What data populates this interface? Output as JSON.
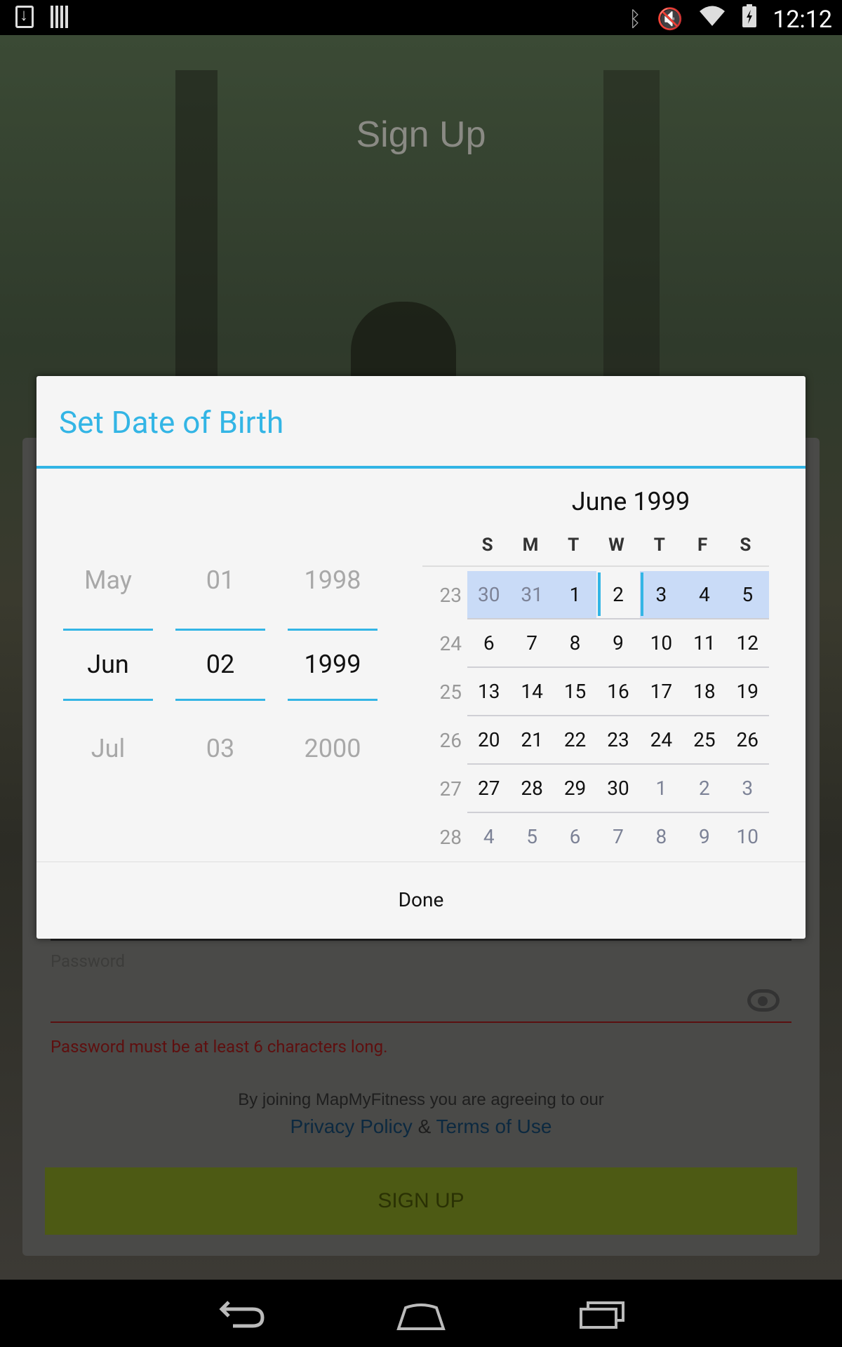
{
  "status_bar": {
    "time": "12:12",
    "left_icons": [
      "download-icon",
      "barcode-icon"
    ],
    "right_icons": [
      "bluetooth-icon",
      "mute-icon",
      "wifi-icon",
      "battery-charging-icon"
    ]
  },
  "background_app": {
    "title": "Sign Up",
    "password_label": "Password",
    "password_error": "Password must be at least 6 characters long.",
    "terms_line": "By joining MapMyFitness you are agreeing to our",
    "privacy_link": "Privacy Policy",
    "terms_ampersand": "&",
    "terms_link": "Terms of Use",
    "signup_button": "SIGN UP",
    "colors": {
      "error": "#5e0f0f",
      "link": "#0c2940",
      "signup_button": "#4d5a14"
    }
  },
  "dialog": {
    "title": "Set Date of Birth",
    "accent_color": "#33b5e5",
    "spinners": {
      "month": {
        "prev": "May",
        "current": "Jun",
        "next": "Jul"
      },
      "day": {
        "prev": "01",
        "current": "02",
        "next": "03"
      },
      "year": {
        "prev": "1998",
        "current": "1999",
        "next": "2000"
      }
    },
    "calendar": {
      "month_label": "June 1999",
      "weekday_headers": [
        "S",
        "M",
        "T",
        "W",
        "T",
        "F",
        "S"
      ],
      "weeks": [
        {
          "week": "23",
          "days": [
            "30",
            "31",
            "1",
            "2",
            "3",
            "4",
            "5"
          ]
        },
        {
          "week": "24",
          "days": [
            "6",
            "7",
            "8",
            "9",
            "10",
            "11",
            "12"
          ]
        },
        {
          "week": "25",
          "days": [
            "13",
            "14",
            "15",
            "16",
            "17",
            "18",
            "19"
          ]
        },
        {
          "week": "26",
          "days": [
            "20",
            "21",
            "22",
            "23",
            "24",
            "25",
            "26"
          ]
        },
        {
          "week": "27",
          "days": [
            "27",
            "28",
            "29",
            "30",
            "1",
            "2",
            "3"
          ]
        },
        {
          "week": "28",
          "days": [
            "4",
            "5",
            "6",
            "7",
            "8",
            "9",
            "10"
          ]
        }
      ],
      "selected_date": "2"
    },
    "done_button": "Done"
  }
}
